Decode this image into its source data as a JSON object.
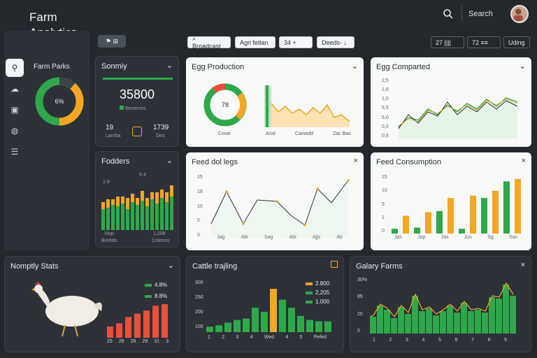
{
  "brand": {
    "line1": "Farm",
    "line2": "Analytics"
  },
  "header": {
    "search_label": "Search"
  },
  "sidebar": {
    "section_label": "Farm Parks",
    "donut_center": "6%"
  },
  "toolbar": {
    "tab_label": "⚑  ⊞",
    "chips": [
      "⌕ Broadcast",
      "Agri fetian",
      "34   +",
      "Deeds-  ↓"
    ],
    "right_chips": [
      "27  ||||",
      "72  ≡≡",
      "Uding"
    ]
  },
  "summary": {
    "title": "Sonmiy",
    "value": "35800",
    "sub": "Reserves",
    "stat1": "19",
    "stat1_label": "Lamba",
    "stat2": "1739",
    "stat2_label": "Deo"
  },
  "egg_production": {
    "title": "Egg Production",
    "donut_center": "78",
    "donut_label": "Cosie",
    "axis_labels": [
      "Acid",
      "Cainedd",
      "Zac Bas"
    ]
  },
  "eggs_compared": {
    "title": "Egg Comparted",
    "y_ticks": [
      "2,5",
      "1,8",
      "1,0",
      "5,5",
      "5,0",
      "0,0",
      "0,6"
    ]
  },
  "fodder": {
    "title": "Fodders",
    "legend": [
      "5  4",
      "1  8"
    ],
    "ticks": [
      "Viop",
      "1,208"
    ],
    "sub_ticks": [
      "Bre6do",
      "Colecos"
    ]
  },
  "feed_ratios": {
    "title": "Feed dol legs",
    "y_ticks": [
      "15",
      "18",
      "10",
      "5",
      "0"
    ],
    "x_labels": [
      "Jag",
      "Abi",
      "Sag",
      "Abi",
      "Ajjs",
      "Ab"
    ]
  },
  "feed_consumption": {
    "title": "Feed Consumption",
    "y_ticks": [
      "15",
      "10",
      "5",
      "1",
      "0"
    ],
    "x_labels": [
      "Jas",
      "Jap",
      "Jas",
      "Jus",
      "Sg",
      "Sas"
    ]
  },
  "monthly_stats": {
    "title": "Nomptly Stats",
    "legend": [
      "4.8%",
      "8.8%"
    ],
    "x_labels": [
      "25",
      "26",
      "28",
      "29",
      "31",
      "3"
    ]
  },
  "cattle_tracking": {
    "title": "Cattle trajling",
    "legend": [
      "2.800",
      "2,205",
      "1.000"
    ],
    "y_ticks": [
      "300",
      "250",
      "200",
      "100"
    ],
    "x_labels": [
      "1",
      "2",
      "3",
      "4",
      "Wed",
      "4",
      "5",
      "Pefed"
    ]
  },
  "dairy_farms": {
    "title": "Galary Farms",
    "y_ticks": [
      "30%",
      "85",
      "20",
      "0"
    ],
    "x_labels": [
      "1",
      "2",
      "3",
      "4",
      "5",
      "6",
      "7",
      "8",
      "9"
    ]
  },
  "colors": {
    "green": "#2fa84a",
    "orange": "#f5a623",
    "red": "#e8503a",
    "dark": "#2c3238"
  }
}
